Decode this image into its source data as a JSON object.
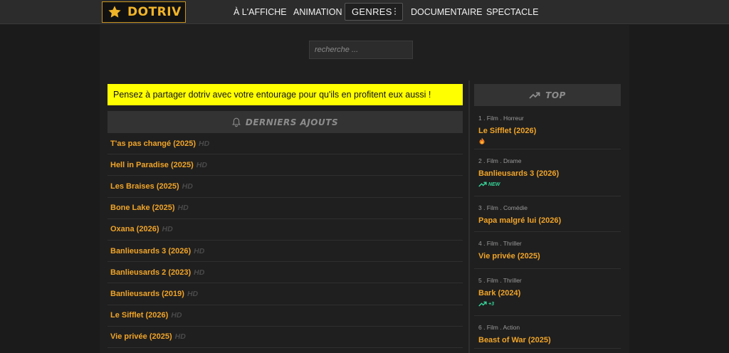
{
  "header": {
    "logo_text": "DOTRIV",
    "nav": [
      {
        "label": "À L'AFFICHE"
      },
      {
        "label": "ANIMATION"
      },
      {
        "label": "GENRES"
      },
      {
        "label": "DOCUMENTAIRE"
      },
      {
        "label": "SPECTACLE"
      }
    ]
  },
  "search": {
    "placeholder": "recherche ..."
  },
  "notice": "Pensez à partager dotriv avec votre entourage pour qu'ils en profitent eux aussi !",
  "latest": {
    "title": "DERNIERS AJOUTS",
    "items": [
      {
        "title": "T'as pas changé (2025)",
        "quality": "HD"
      },
      {
        "title": "Hell in Paradise (2025)",
        "quality": "HD"
      },
      {
        "title": "Les Braises (2025)",
        "quality": "HD"
      },
      {
        "title": "Bone Lake (2025)",
        "quality": "HD"
      },
      {
        "title": "Oxana (2026)",
        "quality": "HD"
      },
      {
        "title": "Banlieusards 3 (2026)",
        "quality": "HD"
      },
      {
        "title": "Banlieusards 2 (2023)",
        "quality": "HD"
      },
      {
        "title": "Banlieusards (2019)",
        "quality": "HD"
      },
      {
        "title": "Le Sifflet (2026)",
        "quality": "HD"
      },
      {
        "title": "Vie privée (2025)",
        "quality": "HD"
      }
    ]
  },
  "top": {
    "title": "TOP",
    "items": [
      {
        "meta": "1 . Film . Horreur",
        "title": "Le Sifflet (2026)",
        "badge": "",
        "icon": "fire-icon"
      },
      {
        "meta": "2 . Film . Drame",
        "title": "Banlieusards 3 (2026)",
        "badge": "NEW",
        "icon": "trending-up-icon"
      },
      {
        "meta": "3 . Film . Comédie",
        "title": "Papa malgré lui (2026)",
        "badge": "",
        "icon": ""
      },
      {
        "meta": "4 . Film . Thriller",
        "title": "Vie privée (2025)",
        "badge": "",
        "icon": ""
      },
      {
        "meta": "5 . Film . Thriller",
        "title": "Bark (2024)",
        "badge": "+3",
        "icon": "trending-up-icon"
      },
      {
        "meta": "6 . Film . Action",
        "title": "Beast of War (2025)",
        "badge": "",
        "icon": ""
      }
    ]
  },
  "colors": {
    "accent": "#f0a429",
    "notice_bg": "#ffff00",
    "trend": "#36d399"
  }
}
